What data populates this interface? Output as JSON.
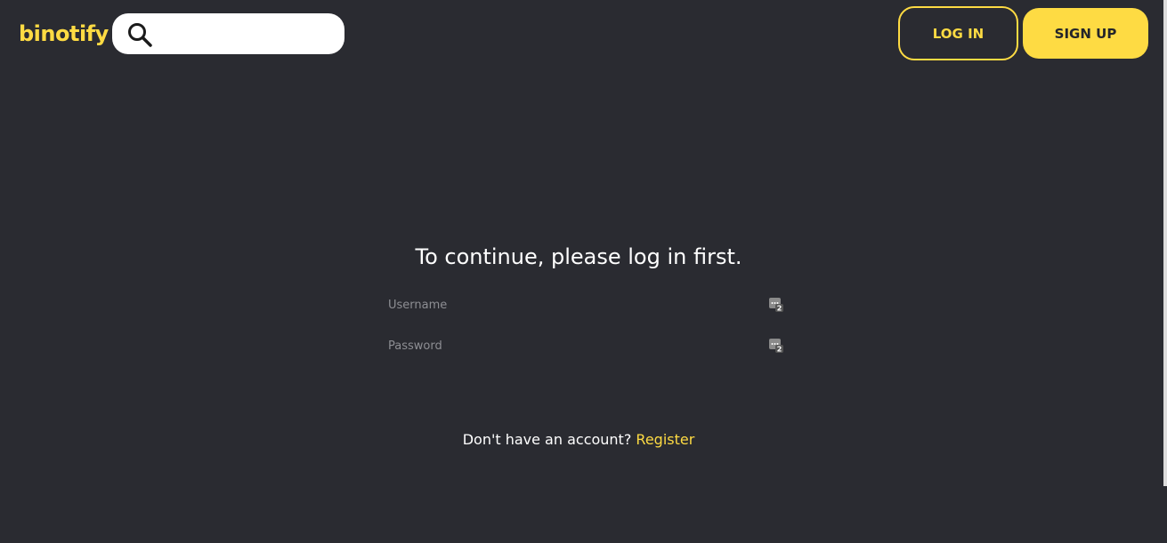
{
  "header": {
    "logo": "binotify",
    "search": {
      "placeholder": "",
      "value": ""
    },
    "login_label": "LOG IN",
    "signup_label": "SIGN UP"
  },
  "main": {
    "prompt": "To continue, please log in first.",
    "username": {
      "placeholder": "Username",
      "value": ""
    },
    "password": {
      "placeholder": "Password",
      "value": ""
    },
    "no_account_text": "Don't have an account?",
    "register_label": "Register"
  },
  "icons": {
    "search": "search-icon",
    "password_manager": "password-manager-icon"
  },
  "colors": {
    "background": "#2a2b31",
    "accent": "#fedb43",
    "text": "#ffffff",
    "placeholder": "#8d8e93"
  }
}
